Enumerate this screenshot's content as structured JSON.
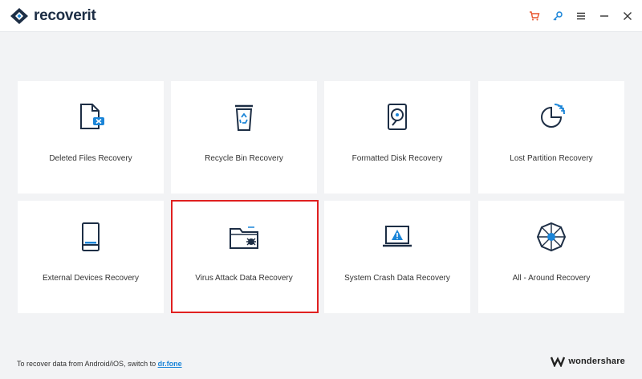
{
  "app": {
    "logo_text": "recoverit"
  },
  "titlebar": {
    "icons": [
      "cart-icon",
      "key-icon",
      "menu-icon",
      "minimize-icon",
      "close-icon"
    ],
    "accent_colors": {
      "cart": "#e8542b",
      "key": "#1b85d8"
    }
  },
  "cards": [
    {
      "label": "Deleted Files Recovery",
      "icon": "deleted-file-icon"
    },
    {
      "label": "Recycle Bin Recovery",
      "icon": "recycle-bin-icon"
    },
    {
      "label": "Formatted Disk Recovery",
      "icon": "formatted-disk-icon"
    },
    {
      "label": "Lost Partition Recovery",
      "icon": "lost-partition-icon"
    },
    {
      "label": "External Devices Recovery",
      "icon": "external-device-icon"
    },
    {
      "label": "Virus Attack Data Recovery",
      "icon": "virus-folder-icon",
      "highlighted": true
    },
    {
      "label": "System Crash Data Recovery",
      "icon": "system-crash-icon"
    },
    {
      "label": "All - Around Recovery",
      "icon": "all-around-icon"
    }
  ],
  "footer": {
    "text": "To recover data from Android/iOS, switch to",
    "link": "dr.fone"
  },
  "brand": {
    "text": "wondershare"
  },
  "colors": {
    "accent_blue": "#1b85d8",
    "highlight_red": "#e02020",
    "dark": "#1d2e45"
  }
}
